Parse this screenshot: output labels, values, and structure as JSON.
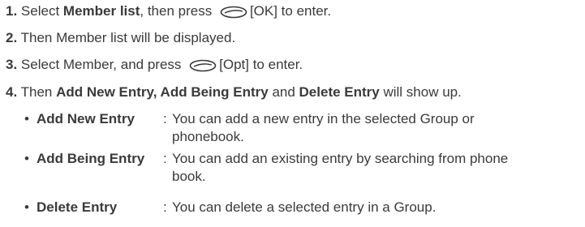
{
  "steps": [
    {
      "num": "1.",
      "p1": "Select ",
      "b1": "Member list",
      "p2": ", then press ",
      "key": "[OK] to enter."
    },
    {
      "num": "2.",
      "p1": "Then Member list will be displayed."
    },
    {
      "num": "3.",
      "p1": "Select Member, and press ",
      "key": "[Opt] to enter."
    },
    {
      "num": "4.",
      "p1": "Then ",
      "b1": "Add New Entry, Add Being Entry",
      "p2": " and ",
      "b2": "Delete Entry",
      "p3": " will show up."
    }
  ],
  "options": [
    {
      "bullet": "•",
      "term": "Add New Entry",
      "colon": ":",
      "desc": "You can add a new entry in the selected Group or phonebook."
    },
    {
      "bullet": "•",
      "term": "Add Being Entry",
      "colon": ":",
      "desc": "You can add an existing entry by searching from phone book."
    },
    {
      "bullet": "•",
      "term": "Delete Entry",
      "colon": ":",
      "desc": "You can delete a selected entry in a Group."
    }
  ]
}
